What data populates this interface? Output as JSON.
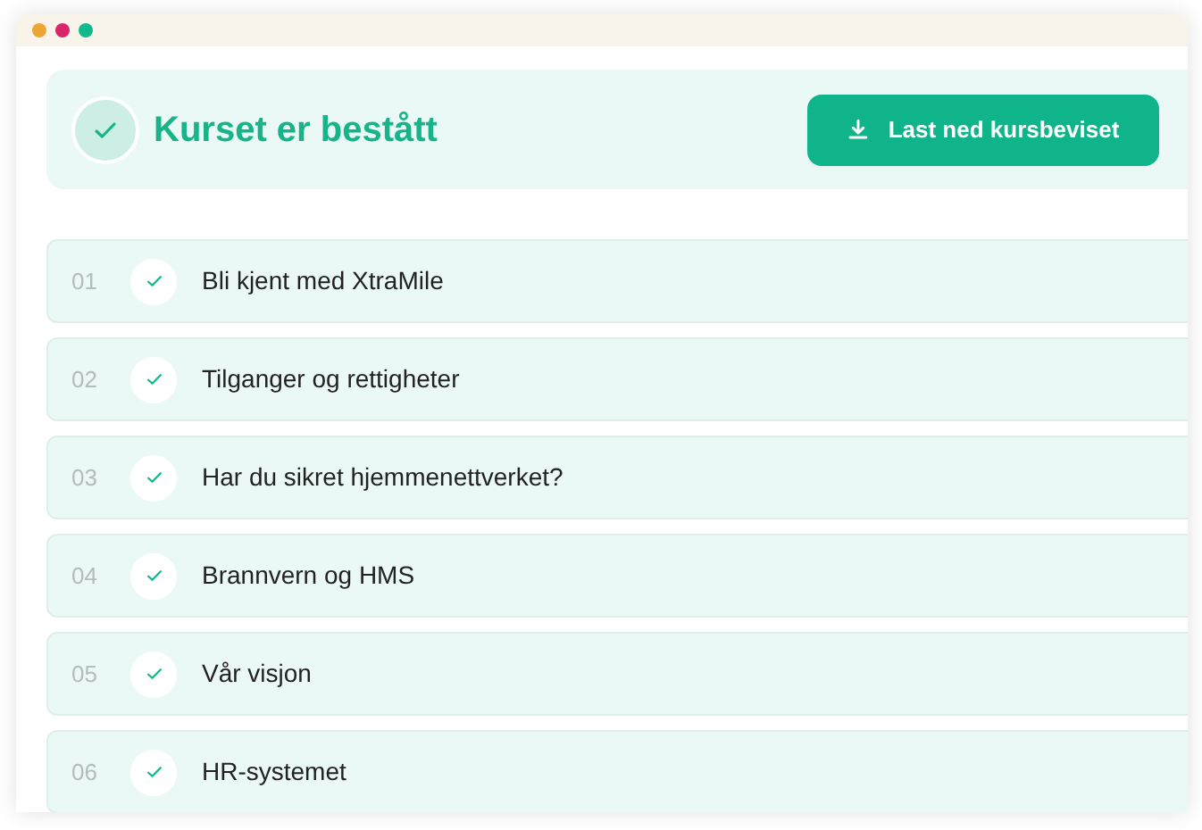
{
  "header": {
    "title": "Kurset er bestått",
    "completed": true,
    "button": "Last ned kursbeviset"
  },
  "lessons": [
    {
      "number": "01",
      "title": "Bli kjent med XtraMile",
      "done": true
    },
    {
      "number": "02",
      "title": "Tilganger og rettigheter",
      "done": true
    },
    {
      "number": "03",
      "title": "Har du sikret hjemmenettverket?",
      "done": true
    },
    {
      "number": "04",
      "title": "Brannvern og HMS",
      "done": true
    },
    {
      "number": "05",
      "title": "Vår visjon",
      "done": true
    },
    {
      "number": "06",
      "title": "HR-systemet",
      "done": true
    }
  ]
}
